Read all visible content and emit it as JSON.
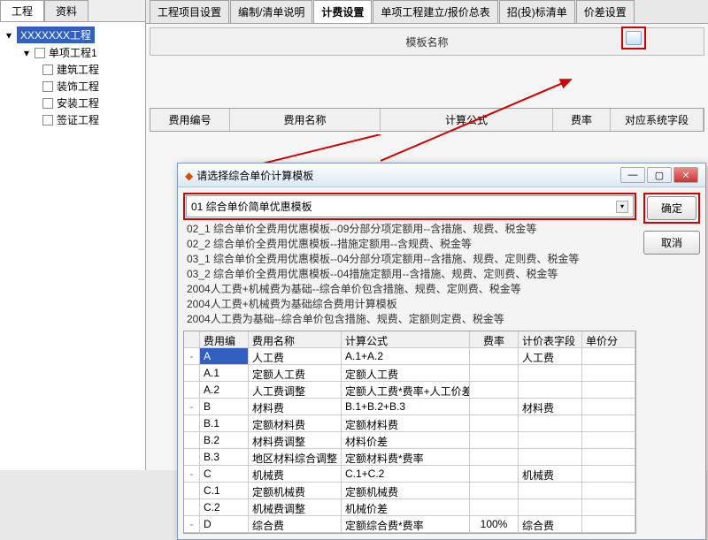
{
  "leftTabs": {
    "active": "工程",
    "inactive": "资料"
  },
  "tree": {
    "root": "XXXXXXX工程",
    "sub": "单项工程1",
    "leaves": [
      "建筑工程",
      "装饰工程",
      "安装工程",
      "签证工程"
    ]
  },
  "topTabs": [
    "工程项目设置",
    "编制/清单说明",
    "计费设置",
    "单项工程建立/报价总表",
    "招(投)标清单",
    "价差设置"
  ],
  "activeTopTab": "计费设置",
  "templateBar": {
    "label": "模板名称"
  },
  "colHeaders": [
    "费用编号",
    "费用名称",
    "计算公式",
    "费率",
    "对应系统字段"
  ],
  "dialog": {
    "title": "请选择综合单价计算模板",
    "selected": "01 综合单价简单优惠模板",
    "options": [
      "02_1 综合单价全费用优惠模板--09分部分项定额用--含措施、规费、税金等",
      "02_2 综合单价全费用优惠模板--措施定额用--含规费、税金等",
      "03_1 综合单价全费用优惠模板--04分部分项定额用--含措施、规费、定则费、税金等",
      "03_2 综合单价全费用优惠模板--04措施定额用--含措施、规费、定则费、税金等",
      "2004人工费+机械费为基础--综合单价包含措施、规费、定则费、税金等",
      "2004人工费+机械费为基础综合费用计算模板",
      "2004人工费为基础--综合单价包含措施、规费、定额则定费、税金等"
    ],
    "okLabel": "确定",
    "cancelLabel": "取消",
    "gridHeaders": [
      "",
      "费用编",
      "费用名称",
      "计算公式",
      "费率",
      "计价表字段",
      "单价分"
    ],
    "gridRows": [
      {
        "exp": "-",
        "id": "A",
        "name": "人工费",
        "formula": "A.1+A.2",
        "rate": "",
        "field": "人工费"
      },
      {
        "exp": "",
        "id": "A.1",
        "name": "定额人工费",
        "formula": "定额人工费",
        "rate": "",
        "field": ""
      },
      {
        "exp": "",
        "id": "A.2",
        "name": "人工费调整",
        "formula": "定额人工费*费率+人工价差",
        "rate": "",
        "field": ""
      },
      {
        "exp": "-",
        "id": "B",
        "name": "材料费",
        "formula": "B.1+B.2+B.3",
        "rate": "",
        "field": "材料费"
      },
      {
        "exp": "",
        "id": "B.1",
        "name": "定额材料费",
        "formula": "定额材料费",
        "rate": "",
        "field": ""
      },
      {
        "exp": "",
        "id": "B.2",
        "name": "材料费调整",
        "formula": "材料价差",
        "rate": "",
        "field": ""
      },
      {
        "exp": "",
        "id": "B.3",
        "name": "地区材料综合调整",
        "formula": "定额材料费*费率",
        "rate": "",
        "field": ""
      },
      {
        "exp": "-",
        "id": "C",
        "name": "机械费",
        "formula": "C.1+C.2",
        "rate": "",
        "field": "机械费"
      },
      {
        "exp": "",
        "id": "C.1",
        "name": "定额机械费",
        "formula": "定额机械费",
        "rate": "",
        "field": ""
      },
      {
        "exp": "",
        "id": "C.2",
        "name": "机械费调整",
        "formula": "机械价差",
        "rate": "",
        "field": ""
      },
      {
        "exp": "-",
        "id": "D",
        "name": "综合费",
        "formula": "定额综合费*费率",
        "rate": "100%",
        "field": "综合费"
      }
    ]
  }
}
